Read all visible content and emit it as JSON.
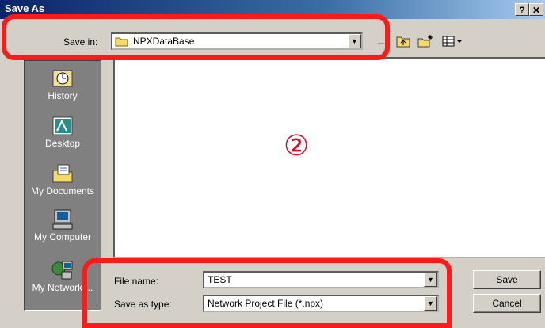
{
  "window": {
    "title": "Save As",
    "help_label": "?",
    "close_label": "✕"
  },
  "save_in": {
    "label": "Save in:",
    "value": "NPXDataBase"
  },
  "places": [
    {
      "label": "History",
      "icon": "history-icon"
    },
    {
      "label": "Desktop",
      "icon": "desktop-icon"
    },
    {
      "label": "My Documents",
      "icon": "my-documents-icon"
    },
    {
      "label": "My Computer",
      "icon": "my-computer-icon"
    },
    {
      "label": "My Network ...",
      "icon": "my-network-icon"
    }
  ],
  "file_area": {
    "marker": "②"
  },
  "file_name": {
    "label": "File name:",
    "value": "TEST"
  },
  "save_as_type": {
    "label": "Save as type:",
    "value": "Network Project File (*.npx)"
  },
  "buttons": {
    "save": "Save",
    "cancel": "Cancel"
  },
  "colors": {
    "highlight": "#ff1a1a",
    "marker": "#e8001c"
  }
}
